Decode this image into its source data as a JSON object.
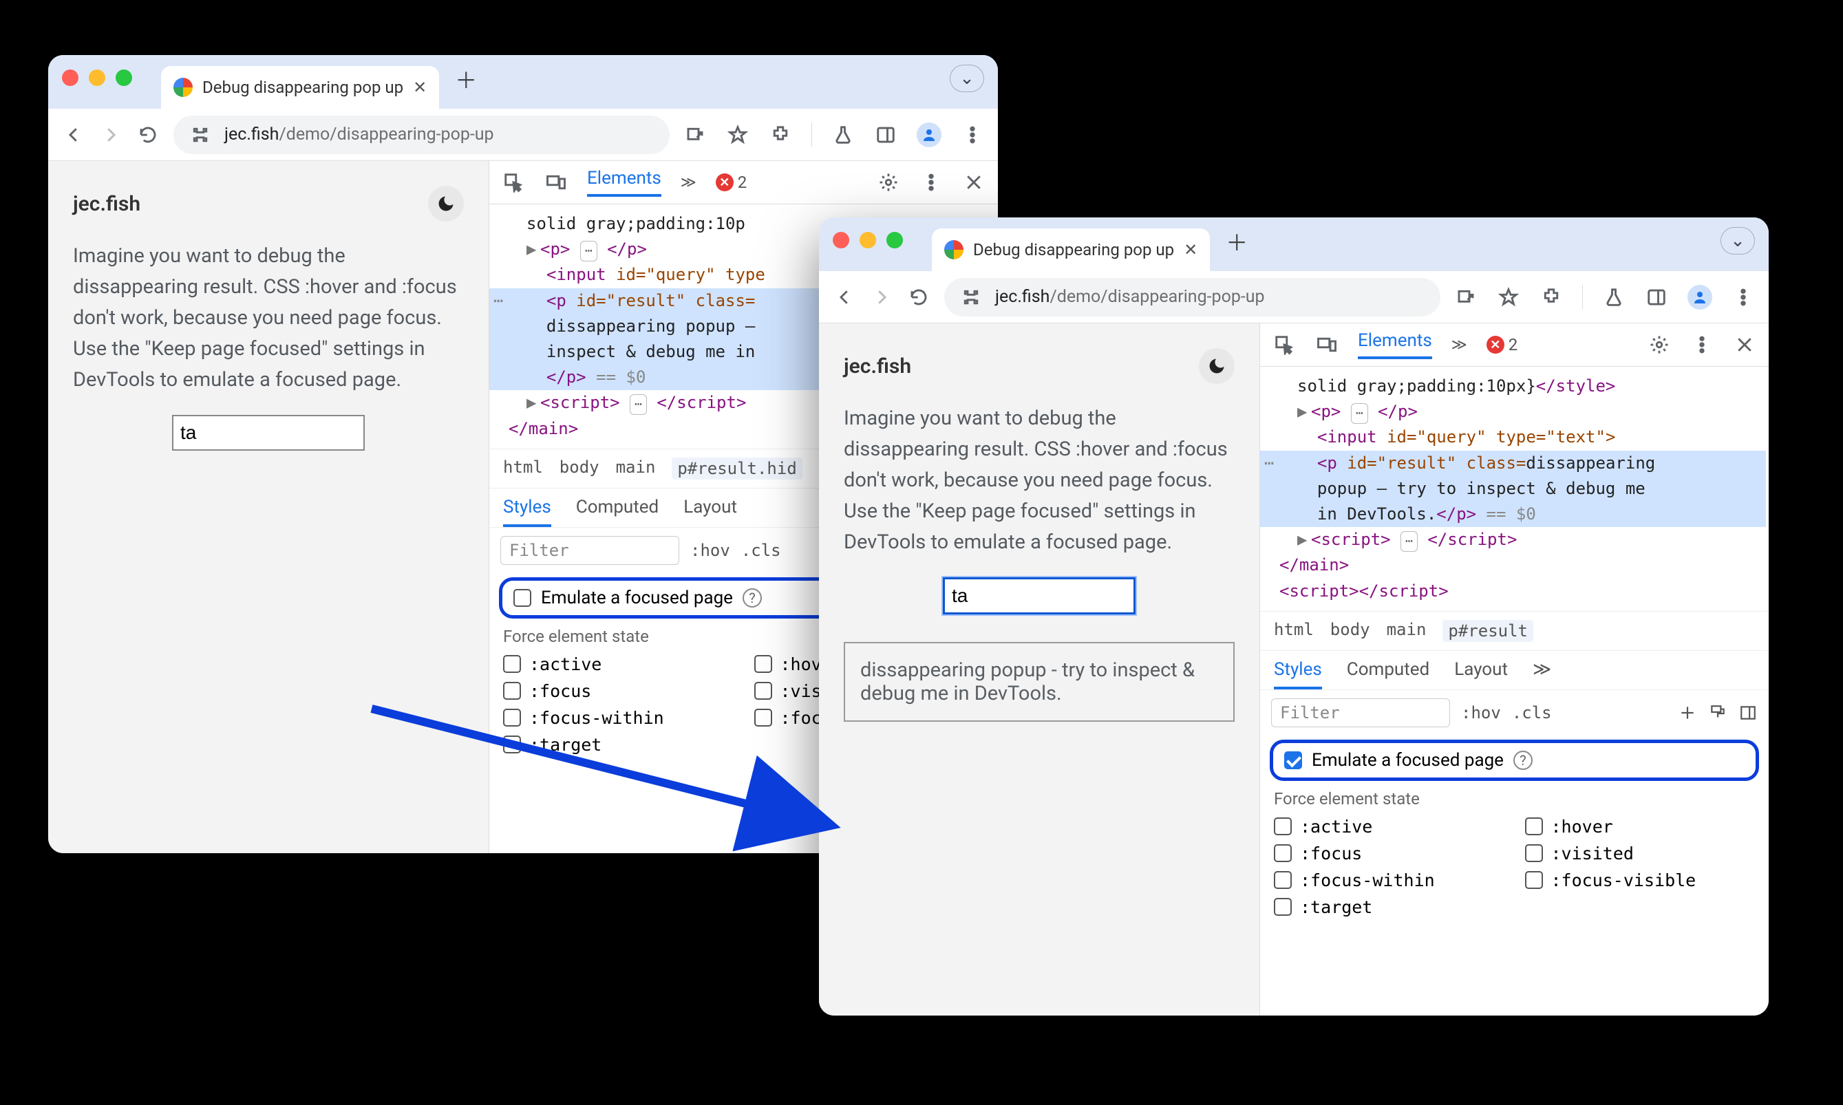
{
  "tab": {
    "title": "Debug disappearing pop up"
  },
  "url": {
    "domain": "jec.fish",
    "path": "/demo/disappearing-pop-up"
  },
  "page": {
    "brand": "jec.fish",
    "paragraph": "Imagine you want to debug the dissappearing result. CSS :hover and :focus don't work, because you need page focus. Use the \"Keep page focused\" settings in DevTools to emulate a focused page.",
    "input_value": "ta",
    "popup_text": "dissappearing popup - try to inspect & debug me in DevTools."
  },
  "devtools": {
    "tab_elements": "Elements",
    "error_count": "2",
    "dom": {
      "style_frag": "solid gray;padding:10p",
      "style_frag_full": "solid gray;padding:10px}",
      "p_open": "<p>",
      "p_close": "</p>",
      "input_line_a": "<input",
      "input_id": "id=\"query\"",
      "input_type_short": "type",
      "input_type_full": "type=\"text\">",
      "p_result_a": "<p",
      "p_result_id": "id=\"result\"",
      "p_result_class_short": "class=",
      "p_result_class_word": "class=",
      "p_result_text_1": "dissappearing popup –",
      "p_result_text_2": "inspect & debug me in",
      "p_result_text_full_1": "dissappearing",
      "p_result_text_full_2": "popup – try to inspect & debug me",
      "p_result_text_full_3": "in DevTools.",
      "p_close2": "</p>",
      "eq0": "== $0",
      "script_open": "<script>",
      "script_close": "</script>",
      "main_close": "</main>",
      "style_close": "</style>"
    },
    "crumbs": {
      "html": "html",
      "body": "body",
      "main": "main",
      "presult_hid": "p#result.hid",
      "presult": "p#result"
    },
    "subtabs": {
      "styles": "Styles",
      "computed": "Computed",
      "layout": "Layout"
    },
    "filter": {
      "placeholder": "Filter",
      "hov": ":hov",
      "cls": ".cls"
    },
    "emulate_label": "Emulate a focused page",
    "force_label": "Force element state",
    "states": {
      "active": ":active",
      "hover": ":hover",
      "focus": ":focus",
      "visited": ":visited",
      "focus_within": ":focus-within",
      "focus_visible": ":focus-visible",
      "target": ":target",
      "visi": ":visi",
      "focu": ":focu",
      "hove": ":hove"
    }
  }
}
